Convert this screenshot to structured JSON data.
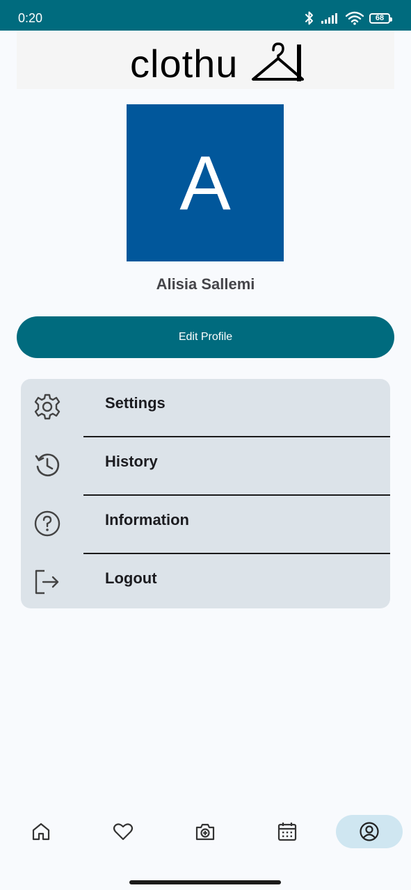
{
  "status_bar": {
    "time": "0:20",
    "battery": "68"
  },
  "logo": {
    "text": "clothu",
    "icon": "hanger-icon"
  },
  "profile": {
    "avatar_letter": "A",
    "avatar_color": "#01579b",
    "name": "Alisia Sallemi",
    "edit_button": "Edit Profile"
  },
  "menu": {
    "items": [
      {
        "label": "Settings",
        "icon": "gear-icon"
      },
      {
        "label": "History",
        "icon": "history-icon"
      },
      {
        "label": "Information",
        "icon": "help-circle-icon"
      },
      {
        "label": "Logout",
        "icon": "logout-icon"
      }
    ]
  },
  "bottom_nav": {
    "items": [
      {
        "icon": "home-icon"
      },
      {
        "icon": "heart-icon"
      },
      {
        "icon": "camera-icon"
      },
      {
        "icon": "calendar-icon"
      },
      {
        "icon": "account-icon",
        "active": true
      }
    ]
  },
  "colors": {
    "primary": "#006b7e",
    "menu_bg": "#dce3e9",
    "active_nav_bg": "#cfe6f1"
  }
}
